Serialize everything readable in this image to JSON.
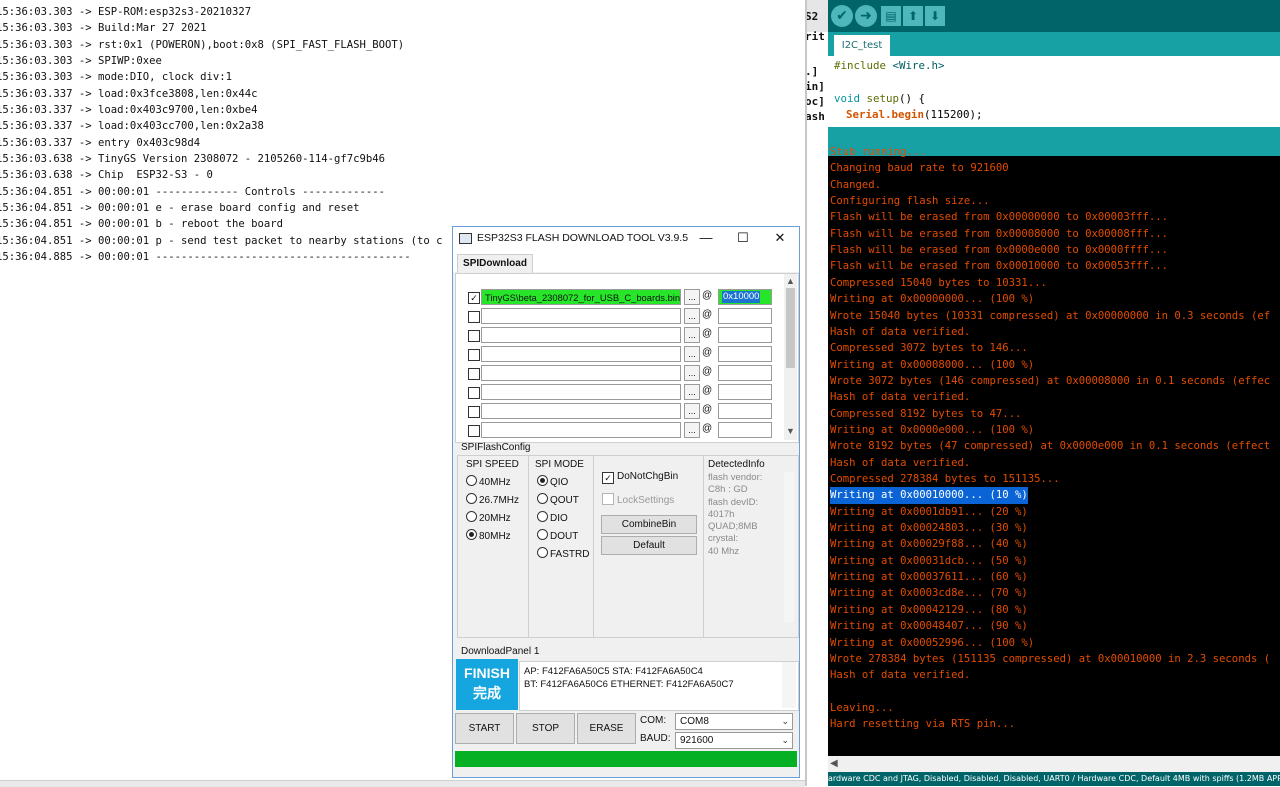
{
  "serial_monitor": {
    "lines": [
      "15:36:03.303 -> ESP-ROM:esp32s3-20210327",
      "15:36:03.303 -> Build:Mar 27 2021",
      "15:36:03.303 -> rst:0x1 (POWERON),boot:0x8 (SPI_FAST_FLASH_BOOT)",
      "15:36:03.303 -> SPIWP:0xee",
      "15:36:03.303 -> mode:DIO, clock div:1",
      "15:36:03.337 -> load:0x3fce3808,len:0x44c",
      "15:36:03.337 -> load:0x403c9700,len:0xbe4",
      "15:36:03.337 -> load:0x403cc700,len:0x2a38",
      "15:36:03.337 -> entry 0x403c98d4",
      "15:36:03.638 -> TinyGS Version 2308072 - 2105260-114-gf7c9b46",
      "15:36:03.638 -> Chip  ESP32-S3 - 0",
      "15:36:04.851 -> 00:00:01 ------------- Controls -------------",
      "15:36:04.851 -> 00:00:01 e - erase board config and reset",
      "15:36:04.851 -> 00:00:01 b - reboot the board",
      "15:36:04.851 -> 00:00:01 p - send test packet to nearby stations (to c",
      "15:36:04.885 -> 00:00:01 ----------------------------------------"
    ]
  },
  "middle_window": {
    "fragments": [
      "S2",
      "rit",
      ".]",
      "in]",
      "oc]",
      "ash"
    ]
  },
  "arduino_ide": {
    "toolbar": {
      "verify_glyph": "✔",
      "upload_glyph": "➜",
      "new_glyph": "▤",
      "open_glyph": "⬆",
      "save_glyph": "⬇"
    },
    "tab_label": "I2C_test",
    "code": {
      "include_kw": "#include",
      "include_file": "<Wire.h>",
      "void_kw": "void",
      "setup_fn": "setup",
      "setup_rest": "() {",
      "serial_obj": "Serial",
      "begin_fn": ".begin",
      "begin_args": "(115200);"
    },
    "console_lines": [
      "Stub running...",
      "Changing baud rate to 921600",
      "Changed.",
      "Configuring flash size...",
      "Flash will be erased from 0x00000000 to 0x00003fff...",
      "Flash will be erased from 0x00008000 to 0x00008fff...",
      "Flash will be erased from 0x0000e000 to 0x0000ffff...",
      "Flash will be erased from 0x00010000 to 0x00053fff...",
      "Compressed 15040 bytes to 10331...",
      "Writing at 0x00000000... (100 %)",
      "Wrote 15040 bytes (10331 compressed) at 0x00000000 in 0.3 seconds (ef",
      "Hash of data verified.",
      "Compressed 3072 bytes to 146...",
      "Writing at 0x00008000... (100 %)",
      "Wrote 3072 bytes (146 compressed) at 0x00008000 in 0.1 seconds (effec",
      "Hash of data verified.",
      "Compressed 8192 bytes to 47...",
      "Writing at 0x0000e000... (100 %)",
      "Wrote 8192 bytes (47 compressed) at 0x0000e000 in 0.1 seconds (effect",
      "Hash of data verified.",
      "Compressed 278384 bytes to 151135...",
      "Writing at 0x00010000... (10 %)",
      "Writing at 0x0001db91... (20 %)",
      "Writing at 0x00024803... (30 %)",
      "Writing at 0x00029f88... (40 %)",
      "Writing at 0x00031dcb... (50 %)",
      "Writing at 0x00037611... (60 %)",
      "Writing at 0x0003cd8e... (70 %)",
      "Writing at 0x00042129... (80 %)",
      "Writing at 0x00048407... (90 %)",
      "Writing at 0x00052996... (100 %)",
      "Wrote 278384 bytes (151135 compressed) at 0x00010000 in 2.3 seconds (",
      "Hash of data verified.",
      "",
      "Leaving...",
      "Hard resetting via RTS pin..."
    ],
    "highlighted_line_index": 21,
    "footer_text": "ardware CDC and JTAG, Disabled, Disabled, Disabled, UART0 / Hardware CDC, Default 4MB with spiffs (1.2MB APP/1.5"
  },
  "flash_tool": {
    "title": "ESP32S3 FLASH DOWNLOAD TOOL V3.9.5",
    "window_buttons": {
      "minimize": "—",
      "maximize": "☐",
      "close": "✕"
    },
    "tab": "SPIDownload",
    "files": [
      {
        "checked": true,
        "path": "TinyGS\\beta_2308072_for_USB_C_boards.bin",
        "address": "0x10000"
      },
      {
        "checked": false,
        "path": "",
        "address": ""
      },
      {
        "checked": false,
        "path": "",
        "address": ""
      },
      {
        "checked": false,
        "path": "",
        "address": ""
      },
      {
        "checked": false,
        "path": "",
        "address": ""
      },
      {
        "checked": false,
        "path": "",
        "address": ""
      },
      {
        "checked": false,
        "path": "",
        "address": ""
      },
      {
        "checked": false,
        "path": "",
        "address": ""
      }
    ],
    "browse_label": "...",
    "at_label": "@",
    "spi_flash_config_label": "SPIFlashConfig",
    "spi_speed": {
      "title": "SPI SPEED",
      "options": [
        "40MHz",
        "26.7MHz",
        "20MHz",
        "80MHz"
      ],
      "selected": "80MHz"
    },
    "spi_mode": {
      "title": "SPI MODE",
      "options": [
        "QIO",
        "QOUT",
        "DIO",
        "DOUT",
        "FASTRD"
      ],
      "selected": "QIO"
    },
    "do_not_chg_bin": {
      "label": "DoNotChgBin",
      "checked": true
    },
    "lock_settings": {
      "label": "LockSettings",
      "checked": false
    },
    "combine_bin_label": "CombineBin",
    "default_label": "Default",
    "detected_info": {
      "title": "DetectedInfo",
      "lines": [
        "flash vendor:",
        "C8h : GD",
        "flash devID:",
        "4017h",
        "QUAD;8MB",
        "crystal:",
        "40 Mhz"
      ]
    },
    "download_panel_label": "DownloadPanel 1",
    "status_en": "FINISH",
    "status_zh": "完成",
    "mac_lines": [
      "AP:  F412FA6A50C5  STA:  F412FA6A50C4",
      "BT:  F412FA6A50C6  ETHERNET:  F412FA6A50C7"
    ],
    "start_label": "START",
    "stop_label": "STOP",
    "erase_label": "ERASE",
    "com_label": "COM:",
    "com_value": "COM8",
    "baud_label": "BAUD:",
    "baud_value": "921600",
    "progress_fraction": 1.0
  }
}
